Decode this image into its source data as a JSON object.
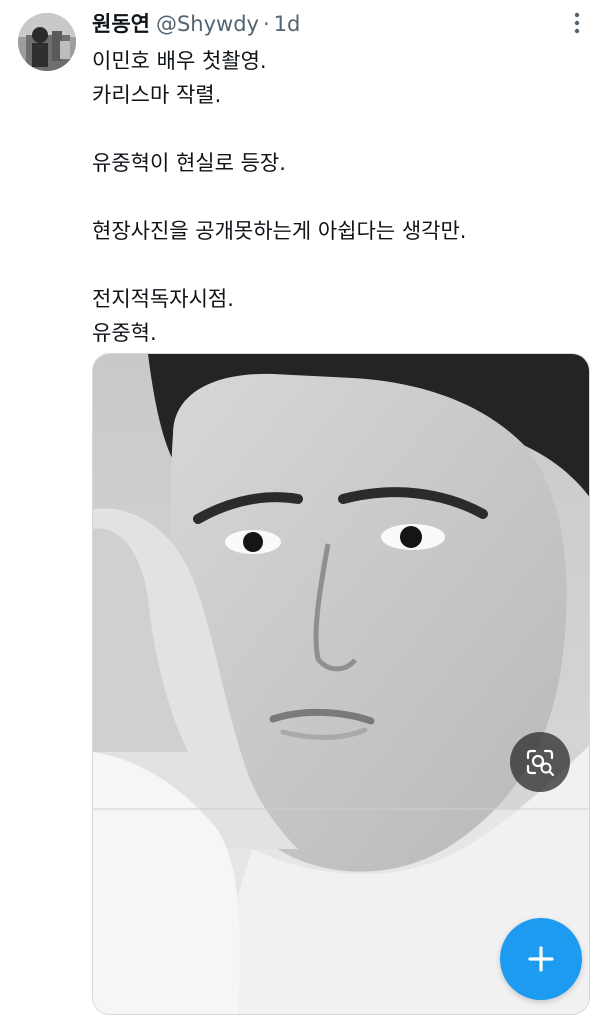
{
  "tweet": {
    "author_name": "원동연",
    "handle": "@Shywdy",
    "separator": "·",
    "time": "1d",
    "lines": [
      "이민호 배우 첫촬영.",
      "카리스마 작렬.",
      "",
      "유중혁이 현실로 등장.",
      "",
      "현장사진을 공개못하는게 아쉽다는 생각만.",
      "",
      "전지적독자시점.",
      "유중혁."
    ]
  },
  "icons": {
    "more": "more-vertical-icon",
    "lens": "visual-search-icon",
    "compose": "plus-icon"
  },
  "colors": {
    "accent": "#1d9bf0",
    "text": "#0f1419",
    "muted": "#536471"
  }
}
